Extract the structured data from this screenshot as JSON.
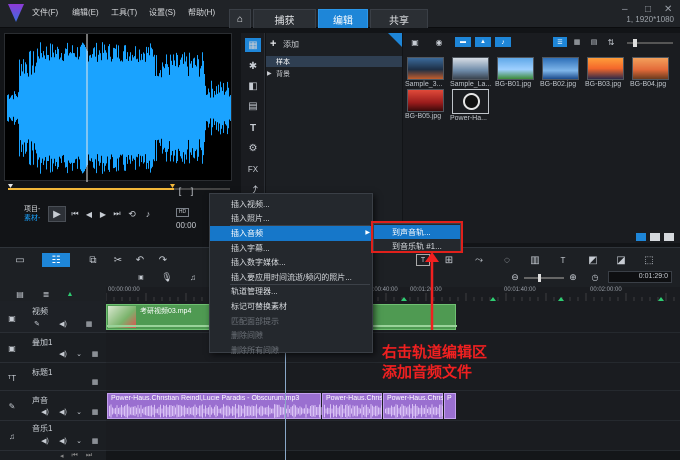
{
  "menubar": [
    "文件(F)",
    "编辑(E)",
    "工具(T)",
    "设置(S)",
    "帮助(H)"
  ],
  "tabs": {
    "capture": "捕获",
    "edit": "编辑",
    "share": "共享"
  },
  "resolution": "1, 1920*1080",
  "player": {
    "mode_project": "项目-",
    "mode_clip": "素材-",
    "timecode": "00:00"
  },
  "library": {
    "add_label": "添加",
    "folders": [
      "样本",
      "背景"
    ],
    "thumbnails": [
      {
        "label": "Sample_3...",
        "kind": "sample1"
      },
      {
        "label": "Sample_La...",
        "kind": "sample2"
      },
      {
        "label": "BG-B01.jpg",
        "kind": "bg1"
      },
      {
        "label": "BG-B02.jpg",
        "kind": "bg2"
      },
      {
        "label": "BG-B03.jpg",
        "kind": "bg3"
      },
      {
        "label": "BG-B04.jpg",
        "kind": "bg4"
      },
      {
        "label": "BG-B05.jpg",
        "kind": "bg5"
      },
      {
        "label": "Power-Ha...",
        "kind": "audio"
      }
    ]
  },
  "timeline": {
    "ruler_ticks": [
      "00:00:00:00",
      "00:00:40:00",
      "00:01:20:00",
      "00:01:40:00",
      "00:02:00:00"
    ],
    "duration": "0:01:29:0",
    "tracks": [
      {
        "name": "视频",
        "icon": "video-track-icon"
      },
      {
        "name": "叠加1",
        "icon": "overlay-track-icon"
      },
      {
        "name": "标题1",
        "icon": "title-track-icon"
      },
      {
        "name": "声音",
        "icon": "voice-track-icon"
      },
      {
        "name": "音乐1",
        "icon": "music-track-icon"
      }
    ],
    "video_clip": "考研视频03.mp4",
    "audio_clips": [
      "Power-Haus.Christian Reindl,Lucie Paradis - Obscurum.mp3",
      "Power-Haus.Chris",
      "Power-Haus.Chris",
      "P"
    ]
  },
  "context_menu": {
    "items": [
      {
        "label": "插入视频...",
        "state": "normal"
      },
      {
        "label": "插入照片...",
        "state": "normal"
      },
      {
        "label": "插入音频",
        "state": "highlight"
      },
      {
        "label": "插入字幕...",
        "state": "normal"
      },
      {
        "label": "插入数字媒体...",
        "state": "normal"
      },
      {
        "label": "插入要应用时间流逝/频闪的照片...",
        "state": "normal"
      },
      {
        "label": "轨道管理器...",
        "state": "normal"
      },
      {
        "label": "标记可替换素材",
        "state": "normal"
      },
      {
        "label": "匹配面部提示",
        "state": "disabled"
      },
      {
        "label": "删除间隙",
        "state": "disabled"
      },
      {
        "label": "删除所有间隙",
        "state": "disabled"
      }
    ],
    "submenu": [
      {
        "label": "到声音轨...",
        "state": "highlight"
      },
      {
        "label": "到音乐轨 #1...",
        "state": "normal"
      }
    ]
  },
  "annotation": {
    "line1": "右击轨道编辑区",
    "line2": "添加音频文件"
  },
  "colors": {
    "accent": "#1e86d8",
    "waveform": "#1aa3ff",
    "video_clip": "#4f9a52",
    "audio_clip": "#9a6fd0",
    "annotation": "#f02020"
  }
}
